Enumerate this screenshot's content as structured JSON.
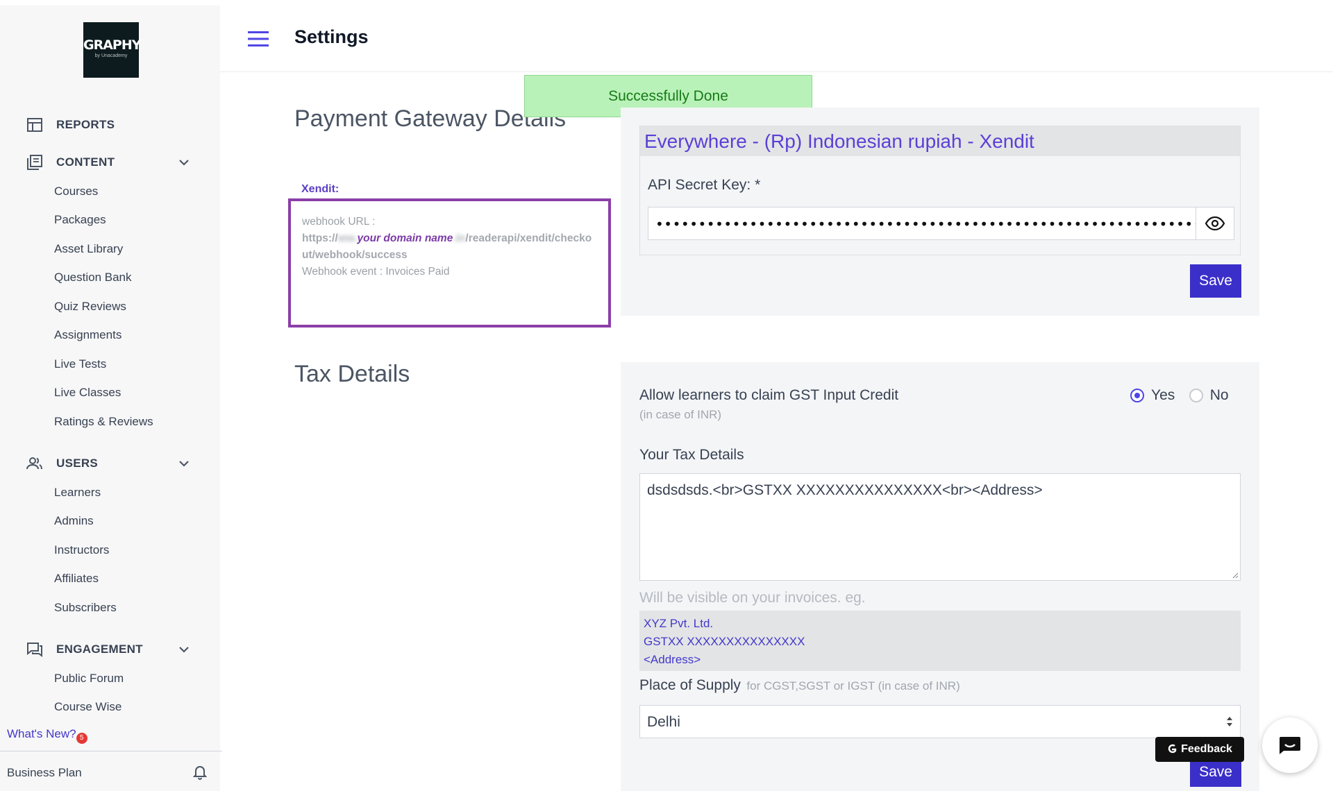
{
  "sidebar": {
    "logo": {
      "title": "GRAPHY",
      "subtitle": "by Unacademy"
    },
    "reports_label": "REPORTS",
    "content": {
      "label": "CONTENT",
      "items": [
        "Courses",
        "Packages",
        "Asset Library",
        "Question Bank",
        "Quiz Reviews",
        "Assignments",
        "Live Tests",
        "Live Classes",
        "Ratings & Reviews"
      ]
    },
    "users": {
      "label": "USERS",
      "items": [
        "Learners",
        "Admins",
        "Instructors",
        "Affiliates",
        "Subscribers"
      ]
    },
    "engagement": {
      "label": "ENGAGEMENT",
      "items": [
        "Public Forum",
        "Course Wise"
      ]
    },
    "whats_new": "What's New?",
    "whats_new_count": "5",
    "business_plan": "Business Plan"
  },
  "header": {
    "title": "Settings"
  },
  "toast": {
    "message": "Successfully Done"
  },
  "payment": {
    "section_title": "Payment Gateway Details",
    "provider_label": "Xendit:",
    "webhook_label": "webhook URL :",
    "url_prefix": "https://",
    "url_blur_left": "ww.",
    "url_domain": "your domain name",
    "url_blur_right": ".in",
    "url_suffix": "/readerapi/xendit/checkout/webhook/success",
    "webhook_event": "Webhook event : Invoices Paid",
    "gateway_title": "Everywhere - (Rp) Indonesian rupiah - Xendit",
    "api_key_label": "API Secret Key: *",
    "api_key_value": "••••••••••••••••••••••••••••••••••••••••••••••••••••••••••••••••••••••",
    "save_label": "Save"
  },
  "tax": {
    "section_title": "Tax Details",
    "gst_question": "Allow learners to claim GST Input Credit",
    "gst_note": "(in case of INR)",
    "yes_label": "Yes",
    "no_label": "No",
    "selected": "Yes",
    "your_tax_label": "Your Tax Details",
    "tax_value": "dsdsdsds.<br>GSTXX XXXXXXXXXXXXXXX<br><Address>",
    "visible_note": "Will be visible on your invoices. eg.",
    "example_lines": [
      "XYZ Pvt. Ltd.",
      "GSTXX XXXXXXXXXXXXXXX",
      "<Address>"
    ],
    "supply_label": "Place of Supply",
    "supply_note": "for CGST,SGST or IGST (in case of INR)",
    "supply_value": "Delhi",
    "save_label": "Save"
  },
  "feedback_label": "Feedback",
  "colors": {
    "accent": "#3b2fc9",
    "heading_link": "#5b3fd6",
    "toast_bg": "#b9f2b9",
    "highlight_border": "#8b3fa8"
  }
}
